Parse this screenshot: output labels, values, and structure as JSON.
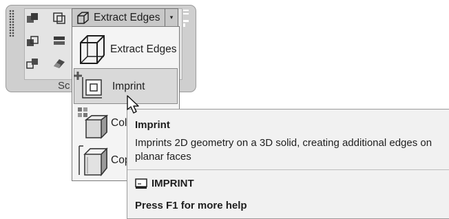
{
  "ribbon_panel": {
    "label": "Sc",
    "split_button": {
      "label": "Extract Edges",
      "icon": "extract-edges-icon",
      "dropdown_arrow": "▾"
    },
    "tool_icons": [
      "box-union-icon",
      "box-subtract-icon",
      "box-copy-icon",
      "layers-icon",
      "shell-icon",
      "separate-icon",
      "eraser-icon"
    ]
  },
  "dropdown": {
    "items": [
      {
        "label": "Extract Edges",
        "icon": "extract-edges-icon"
      },
      {
        "label": "Imprint",
        "icon": "imprint-icon",
        "hovered": true
      },
      {
        "label": "Col",
        "icon": "color-faces-icon"
      },
      {
        "label": "Cop",
        "icon": "copy-edges-icon"
      }
    ]
  },
  "tooltip": {
    "title": "Imprint",
    "description": "Imprints 2D geometry on a 3D solid, creating additional edges on planar faces",
    "command": "IMPRINT",
    "command_icon": "command-line-icon",
    "help": "Press F1 for more help"
  },
  "colors": {
    "panel_bg": "#cfcfcf",
    "menu_bg": "#f4f4f4",
    "hover_bg": "#d9d9d9",
    "tooltip_bg": "#f1f1f1"
  }
}
